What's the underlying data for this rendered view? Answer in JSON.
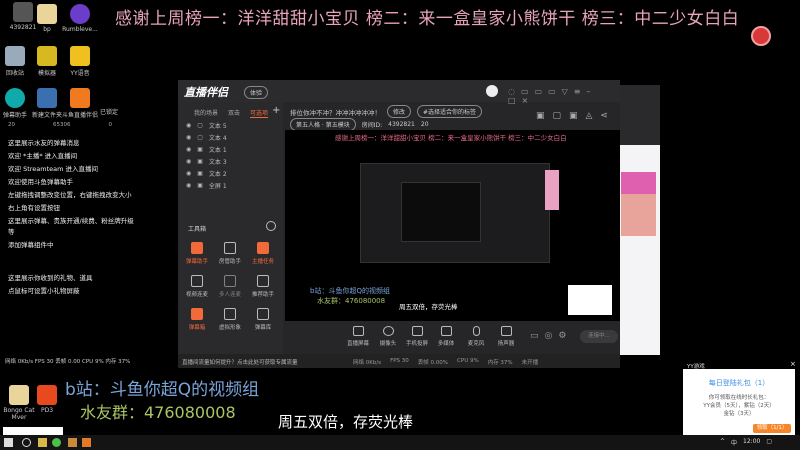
{
  "banner": "感谢上周榜一：洋洋甜甜小宝贝 榜二：来一盒皇家小熊饼干 榜三：中二少女白白",
  "desktop": {
    "room_id": "4392821",
    "icons": [
      "bp",
      "Rumbleve...",
      "回收站",
      "模拟器",
      "YY语音",
      "弹幕助手",
      "新建文件夹",
      "斗鱼直播伴侣",
      "Bongo Cat Mver",
      "PD3"
    ],
    "locked_label": "已锁定",
    "counts": [
      "20",
      "65306",
      "0"
    ]
  },
  "chat": [
    "这里展示水友的弹幕消息",
    "欢迎 *主播* 进入直播间",
    "欢迎 Streamteam 进入直播间",
    "欢迎使用斗鱼弹幕助手",
    "左键拖拽调整改变位置，右键拖拽改变大小",
    "右上角有设置按钮",
    "这里展示弹幕、贵族开通/续费、粉丝牌升级等",
    "添加弹幕组件中",
    "这里展示你收到的礼物、道具",
    "点鼠标可设置小礼物屏蔽"
  ],
  "chat_stats": "网络 0Kb/s  FPS 30  丢帧 0.00  CPU 9%  内存 37%",
  "app": {
    "name": "直播伴侣",
    "version_pill": "体验",
    "side_tabs": [
      "我的场景",
      "双击",
      "可选项"
    ],
    "layers": [
      "文本 5",
      "文本 4",
      "文本 1",
      "文本 3",
      "文本 2",
      "全屏 1"
    ],
    "toolbox_title": "工具箱",
    "tools": [
      "弹幕助手",
      "房管助手",
      "主播任务",
      "视频连麦",
      "多人连麦",
      "推荐助手",
      "弹幕箱",
      "虚拟形象",
      "弹幕库",
      "",
      "",
      ""
    ],
    "notice": "直播间流量如何提升？点击此处可获取专属流量",
    "room_title": "排位你冲不冲？冲冲冲冲冲冲！",
    "edit_btn": "修改",
    "tag": "#选择适合你的标签",
    "category": "第五人格 · 第五模块",
    "room_label": "房间ID:",
    "room_id": "4392821",
    "fans": "20",
    "controls": [
      "直播屏幕",
      "摄像头",
      "手机投屏",
      "多媒体",
      "麦克风",
      "扬声器"
    ],
    "start_btn": "连接中...",
    "status": [
      "网络 0Kb/s",
      "FPS 30",
      "丢帧 0.00%",
      "CPU 9%",
      "内存 37%",
      "未开播"
    ]
  },
  "overlay": {
    "bilibili": "b站：斗鱼你超Q的视频组",
    "group": "水友群：476080008",
    "notice": "周五双倍，存荧光棒"
  },
  "popup": {
    "app": "YY游戏",
    "title": "每日登陆礼包（1）",
    "line1": "你可领取在线时长礼包：",
    "line2": "YY会员（5天），紫钻（2天）",
    "line3": "金钻（3天）",
    "button": "领取（1/1）"
  },
  "taskbar": {
    "time": "12:00",
    "ime": "中"
  }
}
